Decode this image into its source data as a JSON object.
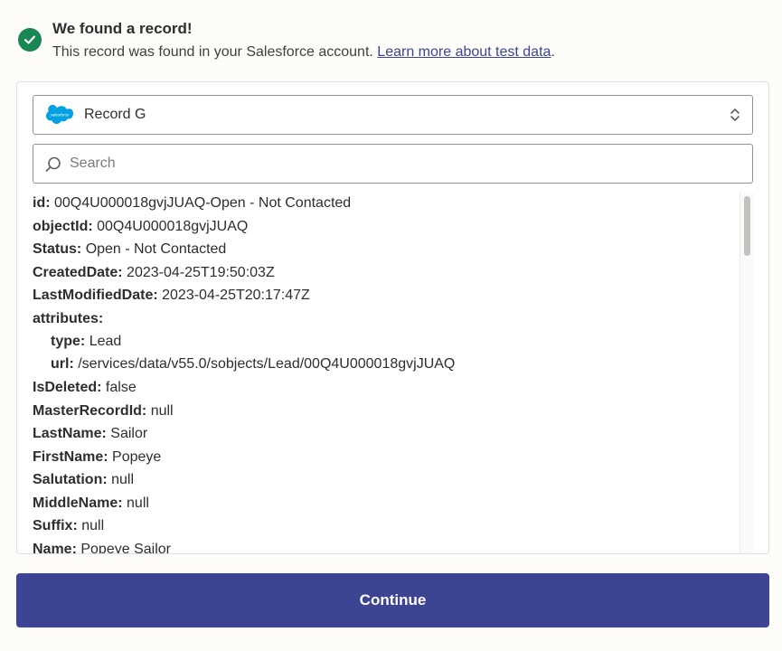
{
  "banner": {
    "title": "We found a record!",
    "body": "This record was found in your Salesforce account.",
    "link": "Learn more about test data",
    "trailing": ".",
    "icon": "check-circle-icon",
    "success_color": "#198754"
  },
  "select": {
    "icon": "salesforce-logo-icon",
    "logo_text": "salesforce",
    "value": "Record G",
    "caret_icon": "chevron-up-down-icon"
  },
  "search": {
    "placeholder": "Search",
    "value": "",
    "icon": "search-icon"
  },
  "record": [
    {
      "key": "id:",
      "value": "00Q4U000018gvjJUAQ-Open - Not Contacted"
    },
    {
      "key": "objectId:",
      "value": "00Q4U000018gvjJUAQ"
    },
    {
      "key": "Status:",
      "value": "Open - Not Contacted"
    },
    {
      "key": "CreatedDate:",
      "value": "2023-04-25T19:50:03Z"
    },
    {
      "key": "LastModifiedDate:",
      "value": "2023-04-25T20:17:47Z"
    },
    {
      "key": "attributes:",
      "value": ""
    },
    {
      "key": "type:",
      "value": "Lead"
    },
    {
      "key": "url:",
      "value": "/services/data/v55.0/sobjects/Lead/00Q4U000018gvjJUAQ"
    },
    {
      "key": "IsDeleted:",
      "value": "false"
    },
    {
      "key": "MasterRecordId:",
      "value": "null"
    },
    {
      "key": "LastName:",
      "value": "Sailor"
    },
    {
      "key": "FirstName:",
      "value": "Popeye"
    },
    {
      "key": "Salutation:",
      "value": "null"
    },
    {
      "key": "MiddleName:",
      "value": "null"
    },
    {
      "key": "Suffix:",
      "value": "null"
    },
    {
      "key": "Name:",
      "value": "Popeye Sailor"
    }
  ],
  "continue_label": "Continue",
  "colors": {
    "accent": "#3d4592",
    "background": "#fdfcf8",
    "salesforce_blue": "#00a1e0"
  }
}
